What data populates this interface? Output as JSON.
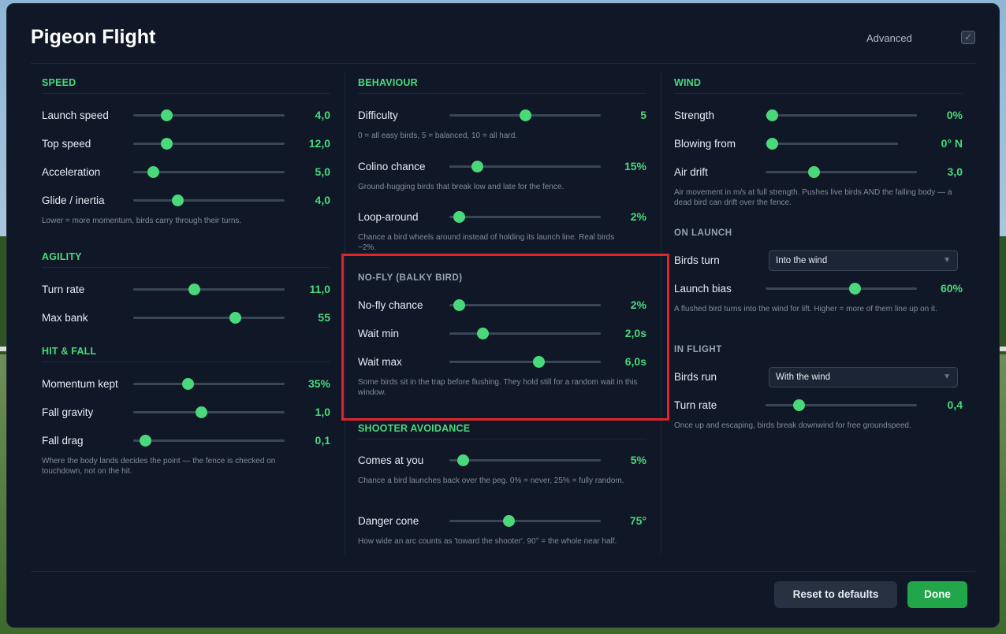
{
  "title": "Pigeon Flight",
  "advanced": {
    "label": "Advanced",
    "checked": true,
    "check_glyph": "✓"
  },
  "colors": {
    "accent": "#4ad97a",
    "panel": "#101828",
    "highlight_box": "#e0242b",
    "done": "#22a64a"
  },
  "speed": {
    "heading": "SPEED",
    "launch_speed": {
      "label": "Launch speed",
      "value": "4,0",
      "fill": 0.22
    },
    "top_speed": {
      "label": "Top speed",
      "value": "12,0",
      "fill": 0.22
    },
    "acceleration": {
      "label": "Acceleration",
      "value": "5,0",
      "fill": 0.13
    },
    "glide": {
      "label": "Glide / inertia",
      "value": "4,0",
      "fill": 0.29
    },
    "hint": "Lower = more momentum, birds carry through their turns."
  },
  "agility": {
    "heading": "AGILITY",
    "turn_rate": {
      "label": "Turn rate",
      "value": "11,0",
      "fill": 0.4
    },
    "max_bank": {
      "label": "Max bank",
      "value": "55",
      "fill": 0.67
    }
  },
  "hit_fall": {
    "heading": "HIT & FALL",
    "momentum": {
      "label": "Momentum kept",
      "value": "35%",
      "fill": 0.36
    },
    "gravity": {
      "label": "Fall gravity",
      "value": "1,0",
      "fill": 0.45
    },
    "drag": {
      "label": "Fall drag",
      "value": "0,1",
      "fill": 0.08
    },
    "hint": "Where the body lands decides the point — the fence is checked on touchdown, not on the hit."
  },
  "behaviour": {
    "heading": "BEHAVIOUR",
    "difficulty": {
      "label": "Difficulty",
      "value": "5",
      "fill": 0.5
    },
    "difficulty_hint": "0 = all easy birds, 5 = balanced, 10 = all hard.",
    "colino": {
      "label": "Colino chance",
      "value": "15%",
      "fill": 0.18
    },
    "colino_hint": "Ground-hugging birds that break low and late for the fence.",
    "loop": {
      "label": "Loop-around",
      "value": "2%",
      "fill": 0.06
    },
    "loop_hint": "Chance a bird wheels around instead of holding its launch line. Real birds ~2%."
  },
  "nofly": {
    "heading": "NO-FLY (BALKY BIRD)",
    "chance": {
      "label": "No-fly chance",
      "value": "2%",
      "fill": 0.06
    },
    "wait_min": {
      "label": "Wait min",
      "value": "2,0s",
      "fill": 0.22
    },
    "wait_max": {
      "label": "Wait max",
      "value": "6,0s",
      "fill": 0.59
    },
    "hint": "Some birds sit in the trap before flushing. They hold still for a random wait in this window."
  },
  "shooter": {
    "heading": "SHOOTER AVOIDANCE",
    "comes": {
      "label": "Comes at you",
      "value": "5%",
      "fill": 0.09
    },
    "comes_hint": "Chance a bird launches back over the peg. 0% = never, 25% = fully random.",
    "cone": {
      "label": "Danger cone",
      "value": "75°",
      "fill": 0.39
    },
    "cone_hint": "How wide an arc counts as 'toward the shooter'. 90° = the whole near half."
  },
  "wind": {
    "heading": "WIND",
    "strength": {
      "label": "Strength",
      "value": "0%",
      "fill": 0.04
    },
    "blowing": {
      "label": "Blowing from",
      "value": "0° N",
      "fill": 0.05
    },
    "drift": {
      "label": "Air drift",
      "value": "3,0",
      "fill": 0.32
    },
    "hint": "Air movement in m/s at full strength. Pushes live birds AND the falling body — a dead bird can drift over the fence."
  },
  "on_launch": {
    "heading": "ON LAUNCH",
    "birds_turn": {
      "label": "Birds turn",
      "value": "Into the wind"
    },
    "bias": {
      "label": "Launch bias",
      "value": "60%",
      "fill": 0.59
    },
    "hint": "A flushed bird turns into the wind for lift. Higher = more of them line up on it."
  },
  "in_flight": {
    "heading": "IN FLIGHT",
    "birds_run": {
      "label": "Birds run",
      "value": "With the wind"
    },
    "turn_rate": {
      "label": "Turn rate",
      "value": "0,4",
      "fill": 0.22
    },
    "hint": "Once up and escaping, birds break downwind for free groundspeed."
  },
  "footer": {
    "reset_label": "Reset to defaults",
    "done_label": "Done"
  }
}
